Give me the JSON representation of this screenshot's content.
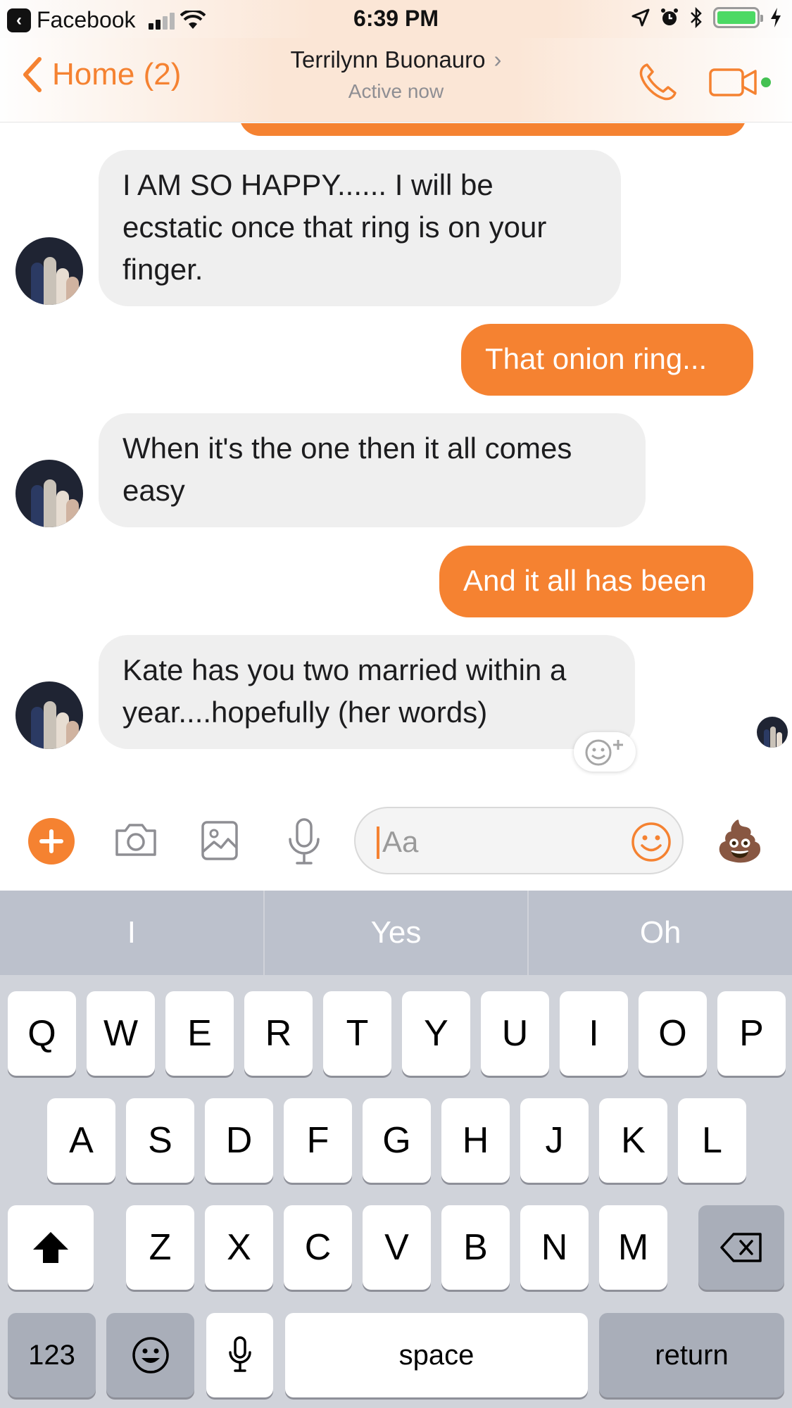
{
  "status_bar": {
    "back_app": "Facebook",
    "time": "6:39 PM"
  },
  "header": {
    "back_label": "Home (2)",
    "contact_name": "Terrilynn Buonauro",
    "status": "Active now",
    "icons": [
      "phone-icon",
      "video-icon"
    ]
  },
  "messages": [
    {
      "dir": "in",
      "text": "I AM SO HAPPY...... I will be ecstatic once that ring is on your finger."
    },
    {
      "dir": "out",
      "text": "That onion ring..."
    },
    {
      "dir": "in",
      "text": "When it's the one then it all comes easy"
    },
    {
      "dir": "out",
      "text": "And it all has been"
    },
    {
      "dir": "in",
      "text": "Kate has you two married within a year....hopefully (her words)"
    }
  ],
  "composer": {
    "placeholder": "Aa",
    "quick_emoji": "💩"
  },
  "keyboard": {
    "predictions": [
      "I",
      "Yes",
      "Oh"
    ],
    "row1": [
      "Q",
      "W",
      "E",
      "R",
      "T",
      "Y",
      "U",
      "I",
      "O",
      "P"
    ],
    "row2": [
      "A",
      "S",
      "D",
      "F",
      "G",
      "H",
      "J",
      "K",
      "L"
    ],
    "row3": [
      "Z",
      "X",
      "C",
      "V",
      "B",
      "N",
      "M"
    ],
    "numbers_key": "123",
    "space_key": "space",
    "return_key": "return"
  },
  "colors": {
    "accent": "#f58231",
    "incoming_bubble": "#efefef",
    "keyboard_bg": "#d0d3da"
  }
}
